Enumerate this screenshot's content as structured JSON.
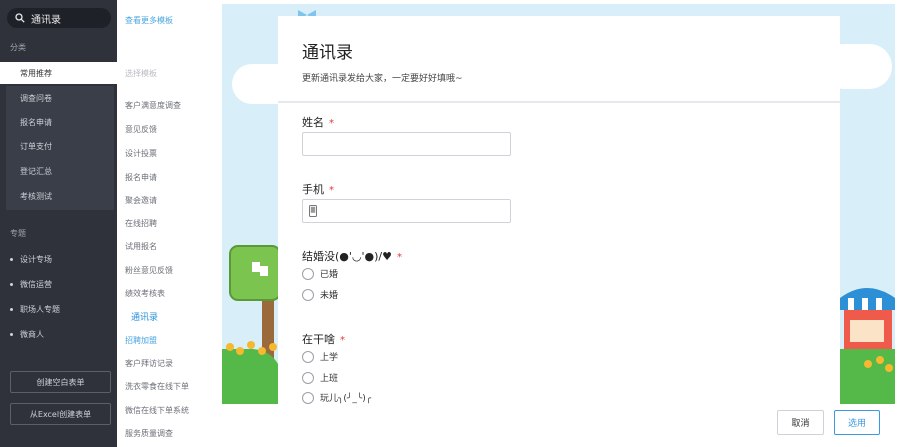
{
  "sidebar": {
    "search_value": "通讯录",
    "section_category": "分类",
    "categories": [
      "常用推荐",
      "调查问卷",
      "报名申请",
      "订单支付",
      "登记汇总",
      "考核测试"
    ],
    "section_topic": "专题",
    "topics": [
      "设计专场",
      "微信运营",
      "职场人专题",
      "微商人"
    ],
    "create_blank_label": "创建空白表单",
    "create_excel_label": "从Excel创建表单"
  },
  "templates": {
    "header_link": "查看更多模板",
    "section_label": "选择模板",
    "items": [
      "客户满意度调查",
      "意见反馈",
      "设计投票",
      "报名申请",
      "聚会邀请",
      "在线招聘",
      "试用报名",
      "粉丝意见反馈",
      "绩效考核表",
      "通讯录",
      "招聘加盟",
      "客户拜访记录",
      "洗衣零食在线下单",
      "微信在线下单系统",
      "服务质量调查"
    ]
  },
  "form": {
    "title": "通讯录",
    "description": "更新通讯录发给大家，一定要好好填哦~",
    "required_mark": "*",
    "questions": {
      "name_label": "姓名",
      "phone_label": "手机",
      "married_label": "结婚没(●'◡'●)/♥",
      "married_options": [
        "已婚",
        "未婚"
      ],
      "doing_label": "在干啥",
      "doing_options": [
        "上学",
        "上班",
        "玩儿╮(╯_╰)╭"
      ]
    }
  },
  "actions": {
    "cancel_label": "取消",
    "use_label": "选用"
  },
  "colors": {
    "sidebar_bg": "#2f323b",
    "accent": "#3a9ae0",
    "required": "#e53935",
    "preview_bg": "#d8eef8",
    "grass": "#55b94a"
  }
}
